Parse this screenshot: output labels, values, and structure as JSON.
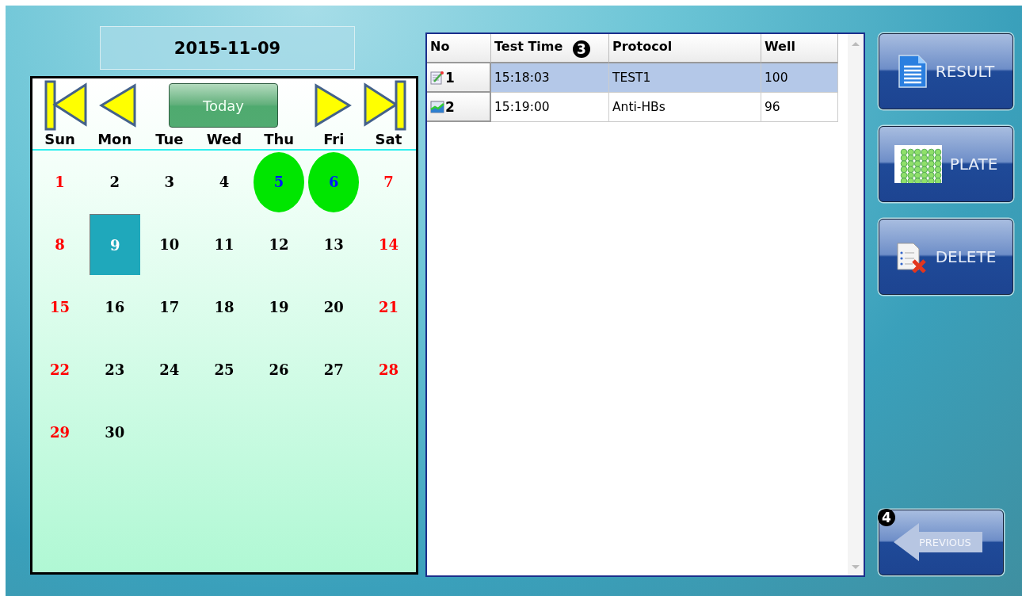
{
  "date_display": "2015-11-09",
  "calendar": {
    "today_button": "Today",
    "weekdays": [
      {
        "label": "Sun"
      },
      {
        "label": "Mon"
      },
      {
        "label": "Tue"
      },
      {
        "label": "Wed"
      },
      {
        "label": "Thu"
      },
      {
        "label": "Fri"
      },
      {
        "label": "Sat"
      }
    ],
    "weeks": [
      [
        {
          "day": "1",
          "kind": "sunday",
          "marked": false,
          "selected": false
        },
        {
          "day": "2",
          "kind": "weekday",
          "marked": false,
          "selected": false
        },
        {
          "day": "3",
          "kind": "weekday",
          "marked": false,
          "selected": false
        },
        {
          "day": "4",
          "kind": "weekday",
          "marked": false,
          "selected": false
        },
        {
          "day": "5",
          "kind": "weekday",
          "marked": true,
          "selected": false
        },
        {
          "day": "6",
          "kind": "weekday",
          "marked": true,
          "selected": false
        },
        {
          "day": "7",
          "kind": "saturday",
          "marked": false,
          "selected": false
        }
      ],
      [
        {
          "day": "8",
          "kind": "sunday",
          "marked": false,
          "selected": false
        },
        {
          "day": "9",
          "kind": "weekday",
          "marked": false,
          "selected": true
        },
        {
          "day": "10",
          "kind": "weekday",
          "marked": false,
          "selected": false
        },
        {
          "day": "11",
          "kind": "weekday",
          "marked": false,
          "selected": false
        },
        {
          "day": "12",
          "kind": "weekday",
          "marked": false,
          "selected": false
        },
        {
          "day": "13",
          "kind": "weekday",
          "marked": false,
          "selected": false
        },
        {
          "day": "14",
          "kind": "saturday",
          "marked": false,
          "selected": false
        }
      ],
      [
        {
          "day": "15",
          "kind": "sunday",
          "marked": false,
          "selected": false
        },
        {
          "day": "16",
          "kind": "weekday",
          "marked": false,
          "selected": false
        },
        {
          "day": "17",
          "kind": "weekday",
          "marked": false,
          "selected": false
        },
        {
          "day": "18",
          "kind": "weekday",
          "marked": false,
          "selected": false
        },
        {
          "day": "19",
          "kind": "weekday",
          "marked": false,
          "selected": false
        },
        {
          "day": "20",
          "kind": "weekday",
          "marked": false,
          "selected": false
        },
        {
          "day": "21",
          "kind": "saturday",
          "marked": false,
          "selected": false
        }
      ],
      [
        {
          "day": "22",
          "kind": "sunday",
          "marked": false,
          "selected": false
        },
        {
          "day": "23",
          "kind": "weekday",
          "marked": false,
          "selected": false
        },
        {
          "day": "24",
          "kind": "weekday",
          "marked": false,
          "selected": false
        },
        {
          "day": "25",
          "kind": "weekday",
          "marked": false,
          "selected": false
        },
        {
          "day": "26",
          "kind": "weekday",
          "marked": false,
          "selected": false
        },
        {
          "day": "27",
          "kind": "weekday",
          "marked": false,
          "selected": false
        },
        {
          "day": "28",
          "kind": "saturday",
          "marked": false,
          "selected": false
        }
      ],
      [
        {
          "day": "29",
          "kind": "sunday",
          "marked": false,
          "selected": false
        },
        {
          "day": "30",
          "kind": "weekday",
          "marked": false,
          "selected": false
        }
      ]
    ]
  },
  "table": {
    "columns": [
      "No",
      "Test Time",
      "Protocol",
      "Well"
    ],
    "rows": [
      {
        "kind": "edit",
        "selected": true,
        "cells": [
          "1",
          "15:18:03",
          "TEST1",
          "100"
        ]
      },
      {
        "kind": "chart",
        "selected": false,
        "cells": [
          "2",
          "15:19:00",
          "Anti-HBs",
          "96"
        ]
      }
    ]
  },
  "buttons": [
    {
      "label": "RESULT",
      "kind": "document"
    },
    {
      "label": "PLATE",
      "kind": "plate"
    },
    {
      "label": "DELETE",
      "kind": "delete"
    }
  ],
  "previous_button": {
    "label": "PREVIOUS"
  },
  "callouts": [
    {
      "label": "3"
    },
    {
      "label": "4"
    }
  ]
}
